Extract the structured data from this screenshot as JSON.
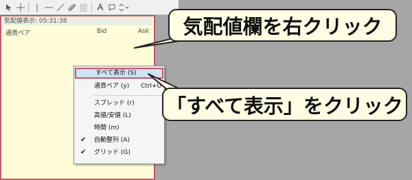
{
  "panel": {
    "title": "気配値表示: 05:31:38",
    "columns": [
      "通貨ペア",
      "Bid",
      "Ask"
    ]
  },
  "context_menu": {
    "items": [
      {
        "label": "すべて表示 (S)",
        "highlighted": true
      },
      {
        "label": "通貨ペア (y)",
        "shortcut": "Ctrl+U"
      },
      {
        "separator": true
      },
      {
        "label": "スプレッド (r)"
      },
      {
        "label": "高値/安値 (L)"
      },
      {
        "label": "時間 (m)"
      },
      {
        "label": "自動整列 (A)",
        "checked": true
      },
      {
        "label": "グリッド (G)",
        "checked": true
      }
    ]
  },
  "callouts": {
    "right_click": "気配値欄を右クリック",
    "show_all": "「すべて表示」をクリック"
  },
  "colors": {
    "accent_red": "#c3566d",
    "panel_bg": "#fffcd7",
    "callout_bg": "#fffde3"
  }
}
